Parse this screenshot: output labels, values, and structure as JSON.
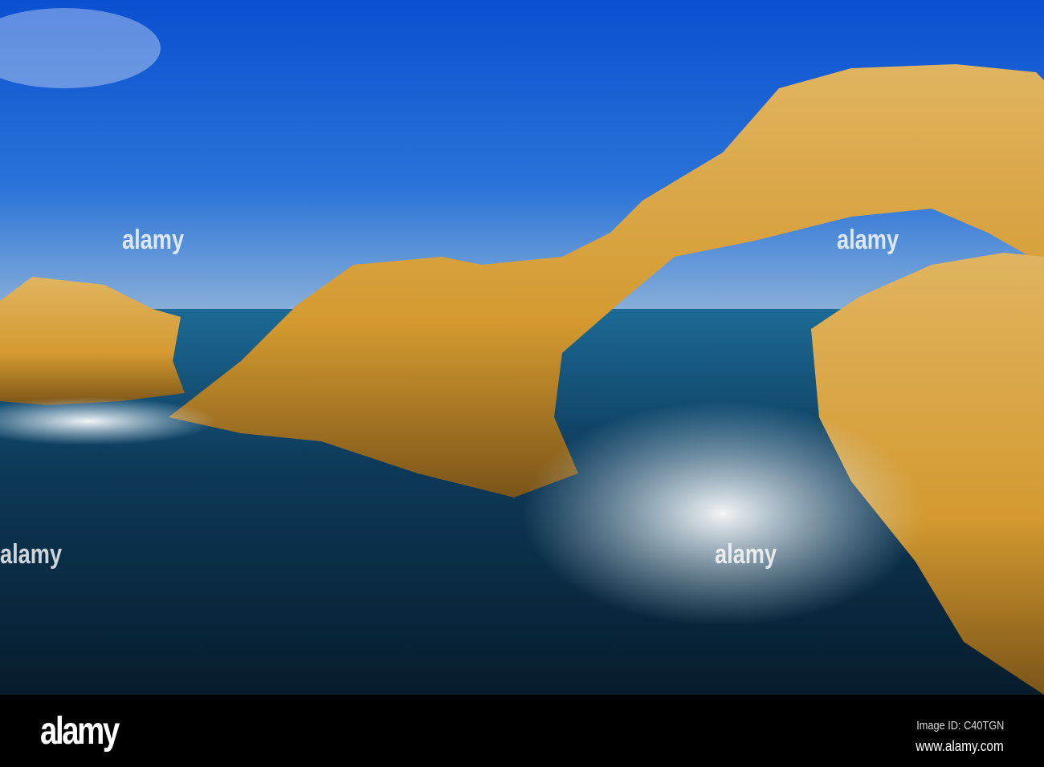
{
  "footer": {
    "logo": "alamy",
    "image_id": "Image ID: C40TGN",
    "url": "www.alamy.com"
  },
  "watermark": "alamy",
  "colors": {
    "sky": "#1a5fd0",
    "sea": "#0d3a5a",
    "rock": "#d9a440"
  }
}
